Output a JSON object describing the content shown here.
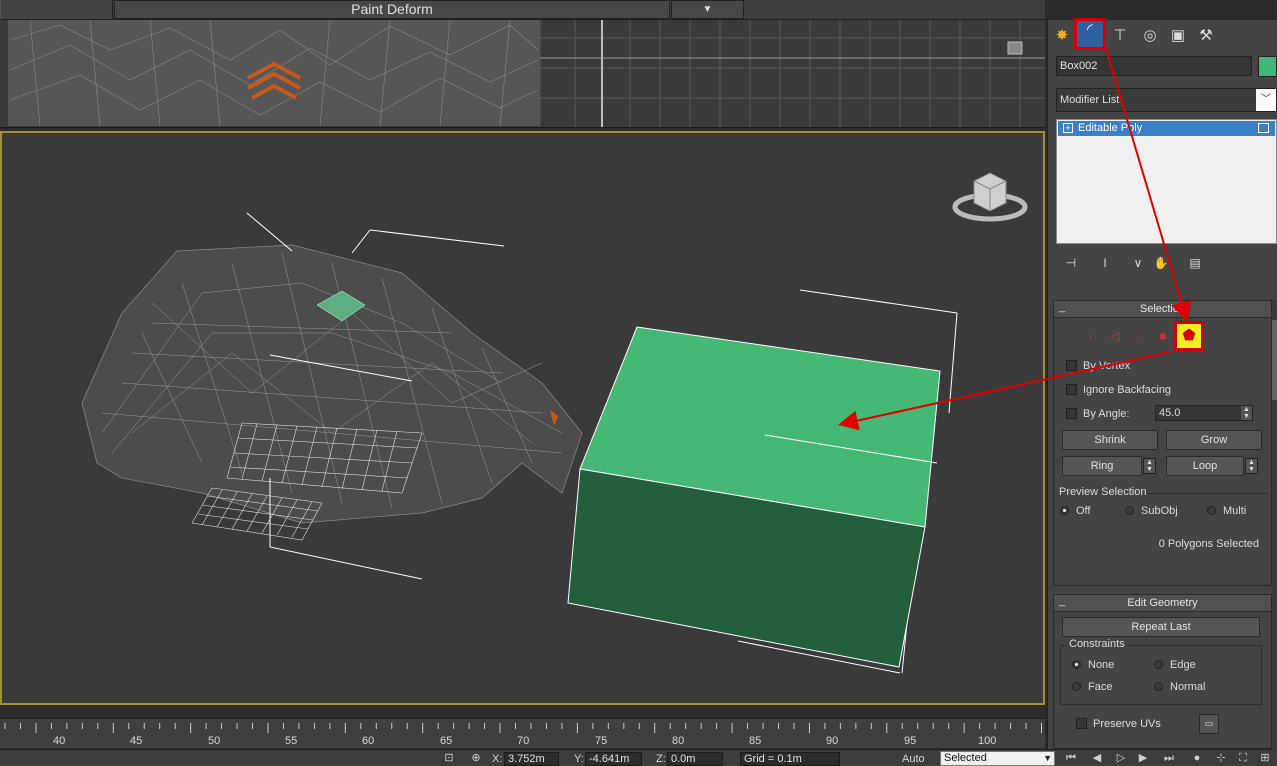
{
  "toolbar": {
    "title": "Paint Deform",
    "dropdown_icon": "chevron-down-icon"
  },
  "ruler": {
    "ticks": [
      "40",
      "45",
      "50",
      "55",
      "60",
      "65",
      "70",
      "75",
      "80",
      "85",
      "90",
      "95",
      "100"
    ]
  },
  "status": {
    "x_label": "X:",
    "x_value": "3.752m",
    "y_label": "Y:",
    "y_value": "-4.641m",
    "z_label": "Z:",
    "z_value": "0.0m",
    "grid": "Grid = 0.1m",
    "auto": "Auto",
    "selected": "Selected"
  },
  "panel": {
    "tabs": [
      "create-icon",
      "modify-icon",
      "hierarchy-icon",
      "motion-icon",
      "display-icon",
      "utilities-icon"
    ],
    "object_name": "Box002",
    "object_color": "#3fb877",
    "modifier_list": "Modifier List",
    "stack_item": "Editable Poly",
    "selection": {
      "title": "Selection",
      "by_vertex": "By Vertex",
      "ignore_backfacing": "Ignore Backfacing",
      "by_angle": "By Angle:",
      "angle_value": "45.0",
      "shrink": "Shrink",
      "grow": "Grow",
      "ring": "Ring",
      "loop": "Loop",
      "preview_title": "Preview Selection",
      "preview_off": "Off",
      "preview_subobj": "SubObj",
      "preview_multi": "Multi",
      "count": "0 Polygons Selected"
    },
    "edit_geometry": {
      "title": "Edit Geometry",
      "repeat_last": "Repeat Last",
      "constraints_title": "Constraints",
      "none": "None",
      "edge": "Edge",
      "face": "Face",
      "normal": "Normal",
      "preserve_uvs": "Preserve UVs"
    }
  },
  "colors": {
    "highlight_red": "#d40000",
    "polygon_yellow": "#f3ec25",
    "box_top": "#45b875",
    "box_front": "#235e3d",
    "viewport_border": "#a88d35"
  }
}
